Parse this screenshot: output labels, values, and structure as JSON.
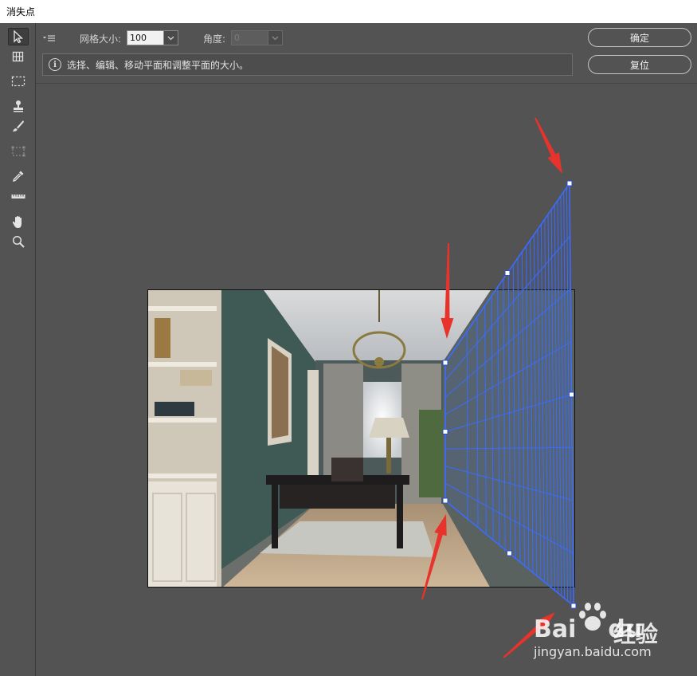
{
  "window": {
    "title": "消失点"
  },
  "toolbar": {
    "tools": [
      {
        "name": "edit-plane-tool",
        "icon": "arrow-cursor-icon",
        "active": true
      },
      {
        "name": "create-plane-tool",
        "icon": "grid-plane-icon"
      },
      {
        "name": "marquee-tool",
        "icon": "dashed-rect-icon"
      },
      {
        "name": "stamp-tool",
        "icon": "stamp-icon"
      },
      {
        "name": "brush-tool",
        "icon": "brush-icon"
      },
      {
        "name": "transform-tool",
        "icon": "transform-icon"
      },
      {
        "name": "eyedropper-tool",
        "icon": "eyedropper-icon"
      },
      {
        "name": "measure-tool",
        "icon": "ruler-icon"
      },
      {
        "name": "hand-tool",
        "icon": "hand-icon"
      },
      {
        "name": "zoom-tool",
        "icon": "zoom-icon"
      }
    ]
  },
  "options": {
    "grid_size_label": "网格大小:",
    "grid_size_value": "100",
    "angle_label": "角度:",
    "angle_value": "0",
    "info_text": "选择、编辑、移动平面和调整平面的大小。"
  },
  "buttons": {
    "ok": "确定",
    "reset": "复位"
  },
  "watermark": {
    "logo": "Bai",
    "logo2": "du",
    "cn": "经验",
    "url": "jingyan.baidu.com"
  },
  "colors": {
    "grid": "#3a6cff",
    "arrow": "#e8322c",
    "bg": "#535353"
  }
}
